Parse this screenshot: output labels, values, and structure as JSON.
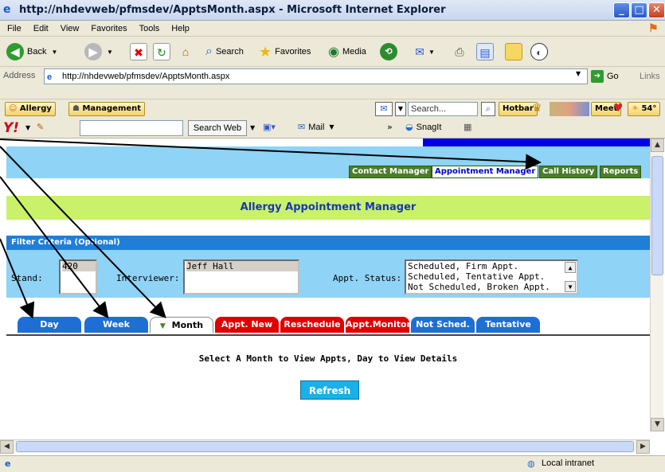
{
  "window": {
    "title": "http://nhdevweb/pfmsdev/ApptsMonth.aspx - Microsoft Internet Explorer"
  },
  "menu": [
    "File",
    "Edit",
    "View",
    "Favorites",
    "Tools",
    "Help"
  ],
  "toolbar": {
    "back": "Back",
    "search": "Search",
    "favorites": "Favorites",
    "media": "Media"
  },
  "address": {
    "label": "Address",
    "url": "http://nhdevweb/pfmsdev/ApptsMonth.aspx",
    "go": "Go",
    "links": "Links"
  },
  "linksbar": {
    "allergy": "Allergy",
    "management": "Management",
    "search_placeholder": "Search...",
    "hotbar": "Hotbar",
    "meet": "Meet",
    "temp": "54°"
  },
  "yahoobar": {
    "search_web": "Search Web",
    "mail": "Mail",
    "snagit": "SnagIt"
  },
  "nav": [
    "Contact Manager",
    "Appointment Manager",
    "Call History",
    "Reports"
  ],
  "banner": "Allergy Appointment Manager",
  "filter": {
    "heading": "Filter Criteria (Optional)",
    "stand_label": "Stand:",
    "stand_value": "420",
    "interviewer_label": "Interviewer:",
    "interviewer_value": "Jeff Hall",
    "status_label": "Appt. Status:",
    "status_options": [
      "Scheduled, Firm Appt.",
      "Scheduled, Tentative Appt.",
      "Not Scheduled, Broken Appt."
    ]
  },
  "tabs": [
    "Day",
    "Week",
    "Month",
    "Appt. New",
    "Reschedule",
    "Appt.Monitor",
    "Not Sched.",
    "Tentative"
  ],
  "instruction": "Select A Month to View Appts, Day to View Details",
  "refresh": "Refresh",
  "status": {
    "zone": "Local intranet"
  }
}
